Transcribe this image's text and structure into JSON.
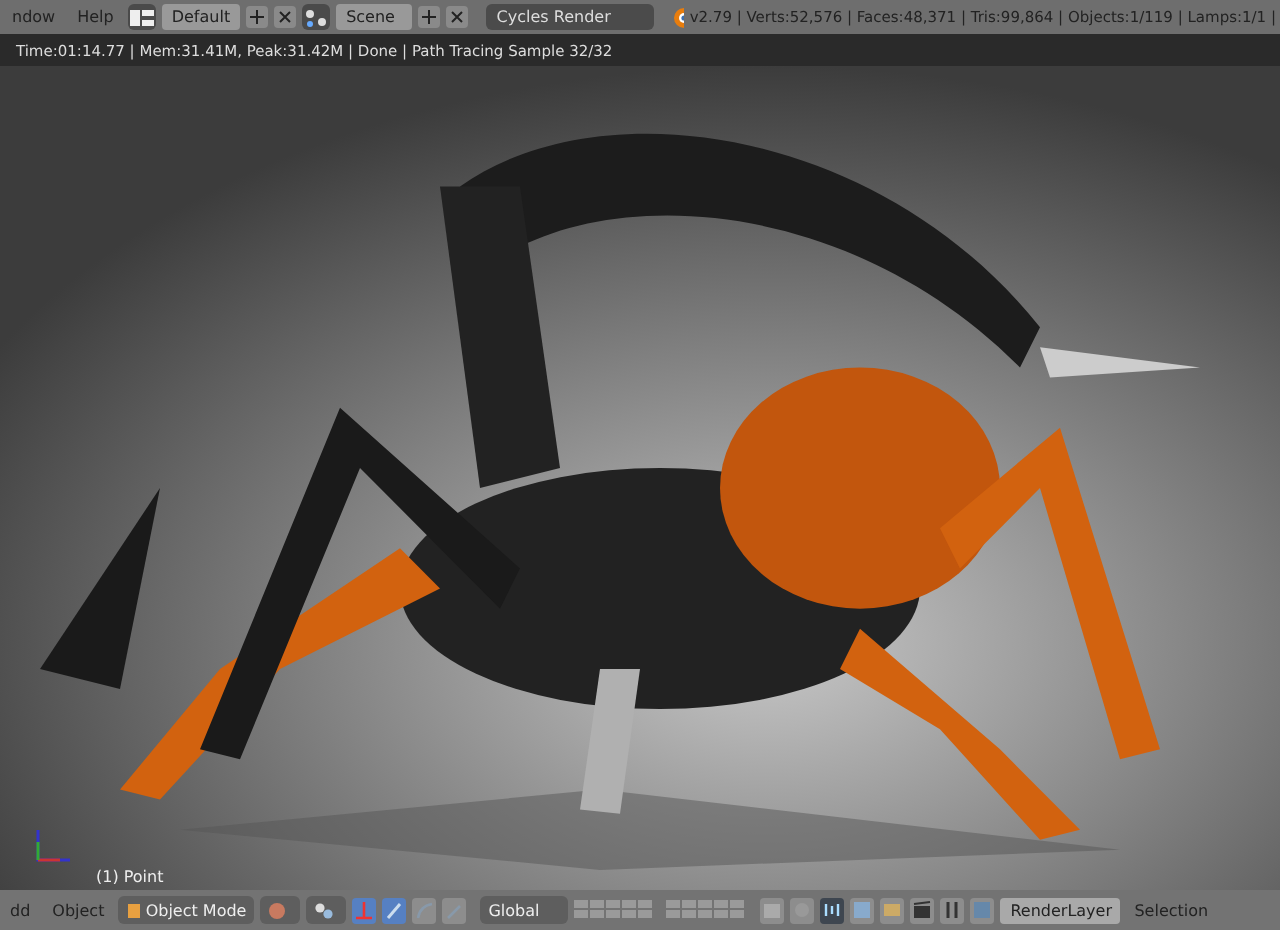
{
  "top_bar": {
    "menus": [
      "ndow",
      "Help"
    ],
    "layout": "Default",
    "scene": "Scene",
    "render_engine": "Cycles Render",
    "stats": "v2.79 | Verts:52,576 | Faces:48,371 | Tris:99,864 | Objects:1/119 | Lamps:1/1 |"
  },
  "render_status": "Time:01:14.77 | Mem:31.41M, Peak:31.42M | Done | Path Tracing Sample 32/32",
  "viewport": {
    "kind": "picture",
    "object_label": "(1) Point"
  },
  "bottom_bar": {
    "menus": [
      "dd",
      "Object"
    ],
    "mode": "Object Mode",
    "orientation": "Global",
    "render_layer": "RenderLayer",
    "selection": "Selection"
  }
}
